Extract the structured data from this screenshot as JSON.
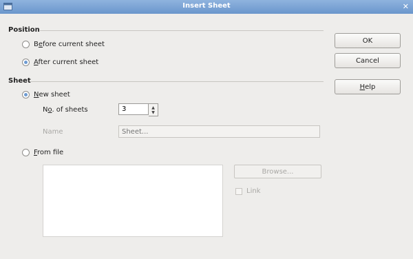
{
  "window": {
    "title": "Insert Sheet",
    "close_glyph": "✕"
  },
  "position": {
    "label": "Position",
    "before_current": {
      "label_pre": "B",
      "label_u": "e",
      "label_post": "fore current sheet",
      "checked": false
    },
    "after_current": {
      "label_pre": "",
      "label_u": "A",
      "label_post": "fter current sheet",
      "checked": true
    }
  },
  "sheet": {
    "label": "Sheet",
    "new_sheet": {
      "label_u": "N",
      "label_post": "ew sheet",
      "checked": true
    },
    "no_of_sheets": {
      "label_pre": "N",
      "label_u": "o",
      "label_post": ". of sheets",
      "value": "3"
    },
    "name": {
      "label": "Name",
      "placeholder": "Sheet..."
    },
    "from_file": {
      "label_u": "F",
      "label_post": "rom file",
      "checked": false
    },
    "browse_label": "Browse...",
    "link_label": "Link"
  },
  "buttons": {
    "ok": "OK",
    "cancel": "Cancel",
    "help_u": "H",
    "help_post": "elp"
  }
}
